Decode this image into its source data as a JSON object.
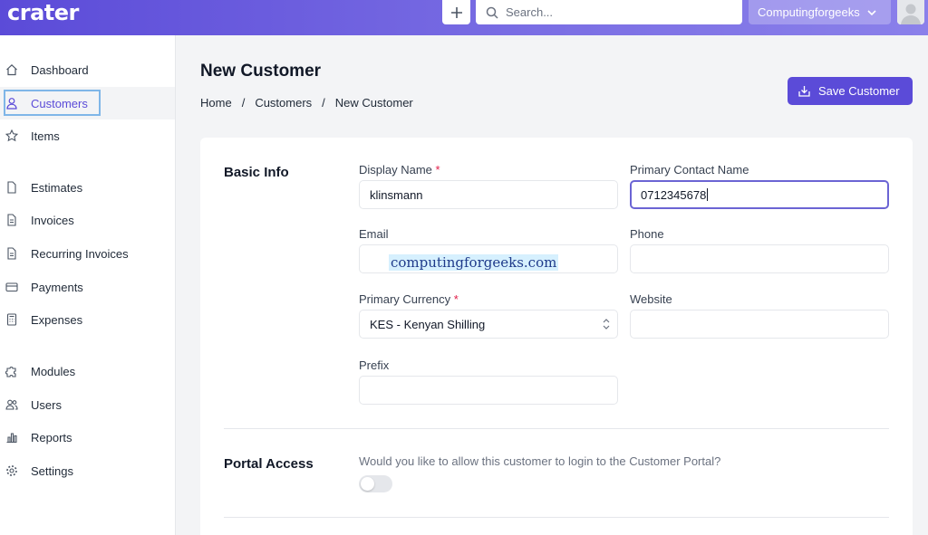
{
  "app": {
    "logo": "crater"
  },
  "header": {
    "search_placeholder": "Search...",
    "company_name": "Computingforgeeks"
  },
  "sidebar": {
    "items": [
      {
        "label": "Dashboard",
        "icon": "home-icon"
      },
      {
        "label": "Customers",
        "icon": "user-icon",
        "active": true
      },
      {
        "label": "Items",
        "icon": "star-icon"
      },
      {
        "label": "Estimates",
        "icon": "document-icon"
      },
      {
        "label": "Invoices",
        "icon": "document-text-icon"
      },
      {
        "label": "Recurring Invoices",
        "icon": "document-text-icon"
      },
      {
        "label": "Payments",
        "icon": "credit-card-icon"
      },
      {
        "label": "Expenses",
        "icon": "calculator-icon"
      },
      {
        "label": "Modules",
        "icon": "puzzle-icon"
      },
      {
        "label": "Users",
        "icon": "users-icon"
      },
      {
        "label": "Reports",
        "icon": "chart-bar-icon"
      },
      {
        "label": "Settings",
        "icon": "cog-icon"
      }
    ]
  },
  "page": {
    "title": "New Customer",
    "breadcrumb": [
      "Home",
      "Customers",
      "New Customer"
    ],
    "save_label": "Save Customer"
  },
  "form": {
    "basic_info_title": "Basic Info",
    "display_name": {
      "label": "Display Name",
      "value": "klinsmann"
    },
    "primary_contact": {
      "label": "Primary Contact Name",
      "value": "0712345678"
    },
    "email": {
      "label": "Email",
      "value": ""
    },
    "phone": {
      "label": "Phone",
      "value": ""
    },
    "currency": {
      "label": "Primary Currency",
      "value": "KES - Kenyan Shilling"
    },
    "website": {
      "label": "Website",
      "value": ""
    },
    "prefix": {
      "label": "Prefix",
      "value": ""
    },
    "required_mark": "*",
    "portal_title": "Portal Access",
    "portal_question": "Would you like to allow this customer to login to the Customer Portal?",
    "portal_enabled": false
  },
  "watermark": "computingforgeeks.com",
  "colors": {
    "accent": "#5b4bd8",
    "required": "#e11d48"
  }
}
